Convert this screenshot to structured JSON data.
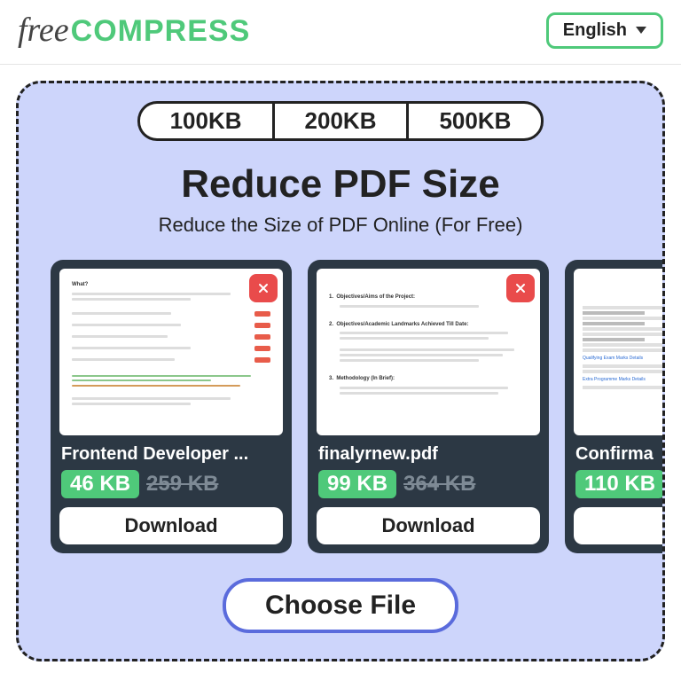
{
  "header": {
    "logo_free": "free",
    "logo_compress": "COMPRESS",
    "language": "English"
  },
  "size_tabs": [
    "100KB",
    "200KB",
    "500KB"
  ],
  "main": {
    "title": "Reduce PDF Size",
    "subtitle": "Reduce the Size of PDF Online (For Free)"
  },
  "cards": [
    {
      "filename": "Frontend Developer ...",
      "new_size": "46 KB",
      "old_size": "259 KB",
      "download_label": "Download"
    },
    {
      "filename": "finalyrnew.pdf",
      "new_size": "99 KB",
      "old_size": "364 KB",
      "download_label": "Download"
    },
    {
      "filename": "Confirma",
      "new_size": "110 KB",
      "old_size": "",
      "download_label": "Dov"
    }
  ],
  "choose_file_label": "Choose File"
}
